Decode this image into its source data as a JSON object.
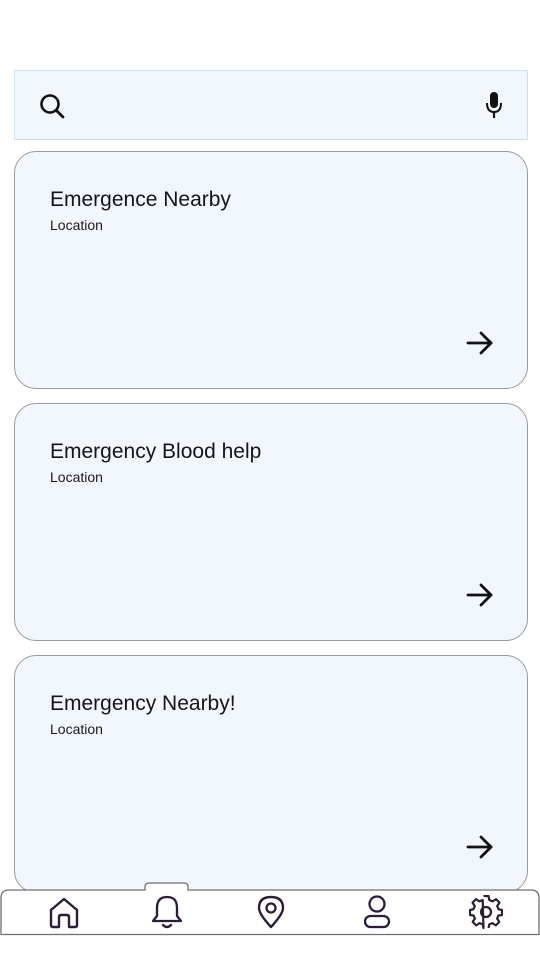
{
  "search": {
    "placeholder": "",
    "value": "",
    "icon": "search-icon",
    "voice_icon": "microphone-icon"
  },
  "cards": [
    {
      "title": "Emergence Nearby",
      "subtitle": "Location",
      "action_icon": "arrow-right-icon"
    },
    {
      "title": "Emergency Blood help",
      "subtitle": "Location",
      "action_icon": "arrow-right-icon"
    },
    {
      "title": "Emergency Nearby!",
      "subtitle": "Location",
      "action_icon": "arrow-right-icon"
    }
  ],
  "bottom_nav": {
    "active": "notifications",
    "items": [
      {
        "id": "home",
        "icon": "home-icon"
      },
      {
        "id": "notifications",
        "icon": "bell-icon"
      },
      {
        "id": "location",
        "icon": "map-pin-icon"
      },
      {
        "id": "profile",
        "icon": "user-icon"
      },
      {
        "id": "settings",
        "icon": "gear-icon"
      }
    ]
  },
  "colors": {
    "card_background": "#f2f7fd",
    "card_border": "#9b9b9b",
    "search_border": "#c9e2f3",
    "nav_icon": "#2b1d3a"
  }
}
